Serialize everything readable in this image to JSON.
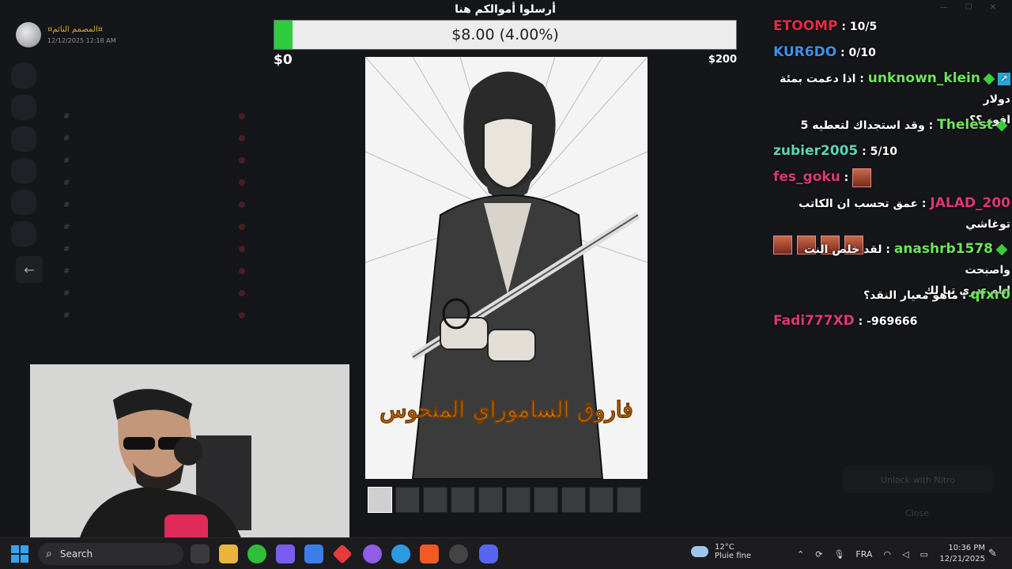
{
  "post": {
    "author": "¤المصمم النائم¤",
    "timestamp": "12/12/2025 12:18 AM"
  },
  "donation": {
    "title": "أرسلوا أموالكم هنا",
    "amount_text": "$8.00 (4.00%)",
    "progress_percent": 4.0,
    "min_label": "$0",
    "max_label": "$200",
    "fill_color": "#2ecc40"
  },
  "image": {
    "title_text": "فاروق الساموراي المنحوس",
    "thumbnail_count": 10,
    "active_thumbnail": 0
  },
  "chat": {
    "messages": [
      {
        "user": "ETOOMP",
        "color": "#e8294a",
        "text": "10/5",
        "dir": "ltr"
      },
      {
        "user": "KUR6DO",
        "color": "#3f8fe8",
        "text": "0/10",
        "dir": "ltr"
      },
      {
        "user": "unknown_klein",
        "color": "#6de55a",
        "text": "اذا دعمت بمئة دولار",
        "text2": "افوز ؟؟",
        "badges": [
          "arrow",
          "diamond"
        ],
        "dir": "rtl"
      },
      {
        "user": "Thelest",
        "color": "#6de55a",
        "text": "وقد استجداك لتعطيه 5",
        "badges": [
          "diamond"
        ],
        "dir": "rtl"
      },
      {
        "user": "zubier2005",
        "color": "#57d8b8",
        "text": "5/10",
        "dir": "ltr"
      },
      {
        "user": "fes_goku",
        "color": "#e0357a",
        "text": "",
        "emotes": 1,
        "dir": "ltr"
      },
      {
        "user": "JALAD_200",
        "color": "#e0357a",
        "text": "عمق تحسب ان الكاتب توغاشي",
        "emotes": 4,
        "dir": "rtl"
      },
      {
        "user": "anashrb1578",
        "color": "#6de55a",
        "text": "لقد خلص النت واصبحت",
        "text2": "انام بدري تبا لك",
        "badges": [
          "diamond"
        ],
        "dir": "rtl"
      },
      {
        "user": "qfxr0",
        "color": "#6de55a",
        "text": "ماهو معيار النقد؟",
        "dir": "rtl"
      },
      {
        "user": "Fadi777XD",
        "color": "#e0357a",
        "text": "-969666",
        "dir": "ltr"
      }
    ]
  },
  "taskbar": {
    "search_placeholder": "Search",
    "weather_temp": "12°C",
    "weather_desc": "Pluie fine",
    "language": "FRA",
    "time": "10:36 PM",
    "date": "12/21/2025"
  },
  "background": {
    "unlock_label": "Unlock with Nitro",
    "close_label": "Close"
  }
}
